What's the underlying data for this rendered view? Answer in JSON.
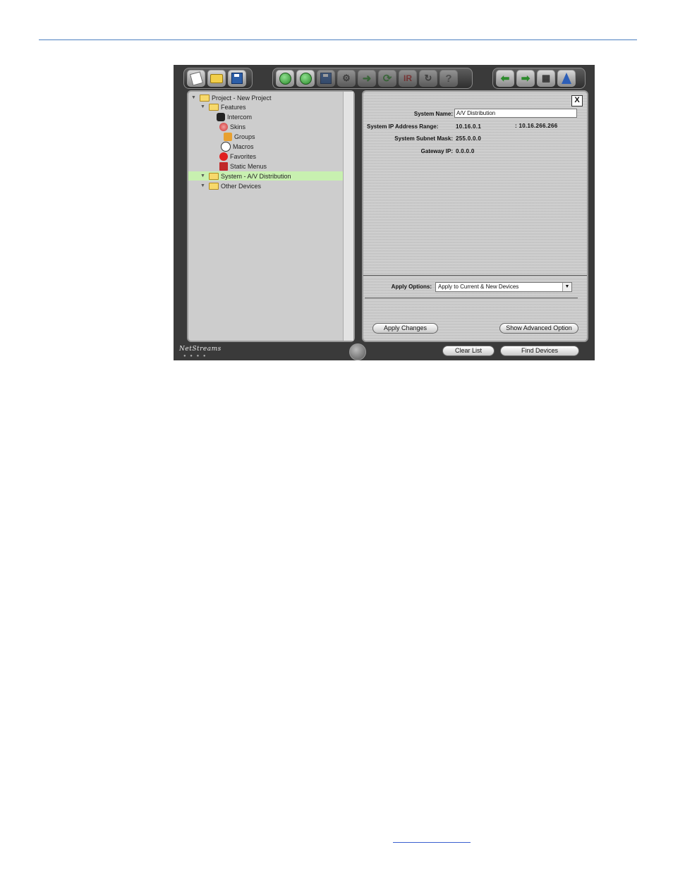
{
  "tree": {
    "project": "Project - New Project",
    "features": "Features",
    "intercom": "Intercom",
    "skins": "Skins",
    "groups": "Groups",
    "macros": "Macros",
    "favorites": "Favorites",
    "static_menus": "Static Menus",
    "system": "System - A/V Distribution",
    "other_devices": "Other Devices"
  },
  "toolbar": {
    "ir_label": "IR",
    "help_label": "?"
  },
  "props": {
    "close_label": "X",
    "system_name_label": "System Name:",
    "system_name_value": "A/V Distribution",
    "ip_range_label": "System IP Address Range:",
    "ip_range_start": "10.16.0.1",
    "ip_range_end": ": 10.16.266.266",
    "subnet_label": "System Subnet Mask:",
    "subnet_value": "255.0.0.0",
    "gateway_label": "Gateway IP:",
    "gateway_value": "0.0.0.0",
    "apply_options_label": "Apply Options:",
    "apply_options_value": "Apply to Current & New Devices",
    "apply_changes_label": "Apply Changes",
    "advanced_label": "Show Advanced Option"
  },
  "footer": {
    "logo": "NetStreams",
    "clear_list_label": "Clear List",
    "find_devices_label": "Find Devices"
  }
}
